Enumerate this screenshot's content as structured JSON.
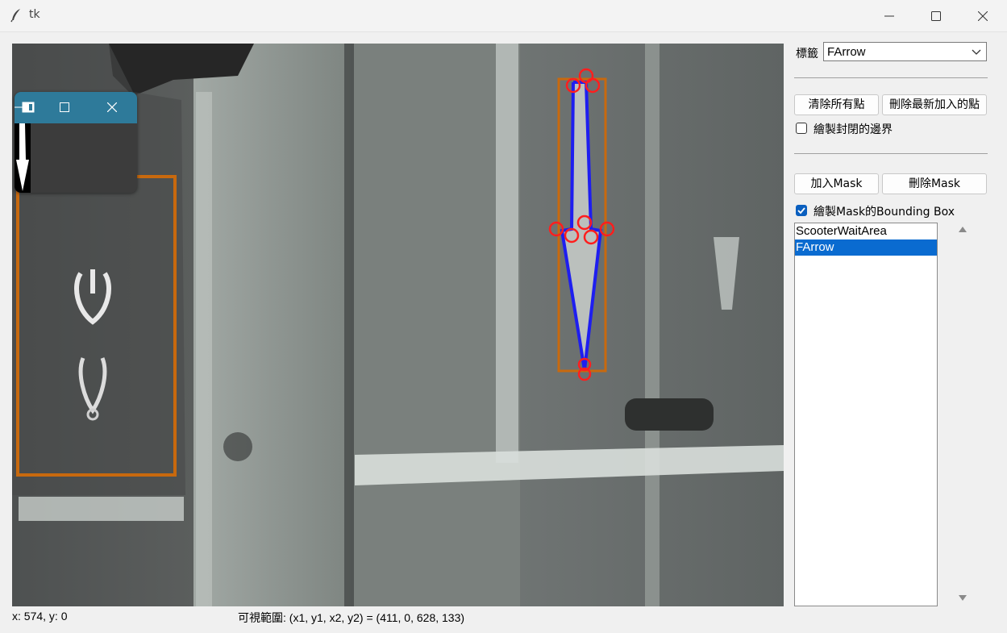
{
  "window": {
    "title": "tk"
  },
  "sidebar": {
    "label_tag": "標籤",
    "tag_selected": "FArrow",
    "btn_clear_all": "清除所有點",
    "btn_delete_last": "刪除最新加入的點",
    "chk_closed_border": {
      "label": "繪製封閉的邊界",
      "checked": false
    },
    "btn_add_mask": "加入Mask",
    "btn_delete_mask": "刪除Mask",
    "chk_bbox": {
      "label": "繪製Mask的Bounding Box",
      "checked": true
    },
    "mask_list": [
      {
        "label": "ScooterWaitArea",
        "selected": false
      },
      {
        "label": "FArrow",
        "selected": true
      }
    ]
  },
  "status": {
    "cursor": "x: 574, y: 0",
    "viewport": "可視範圍: (x1, y1, x2, y2) = (411, 0, 628, 133)"
  },
  "colors": {
    "bbox": "#c8690e",
    "polygon": "#1e1ef0",
    "points": "#ff1e1e",
    "selection": "#0a6bd0",
    "accent_check": "#0a5fbf"
  }
}
